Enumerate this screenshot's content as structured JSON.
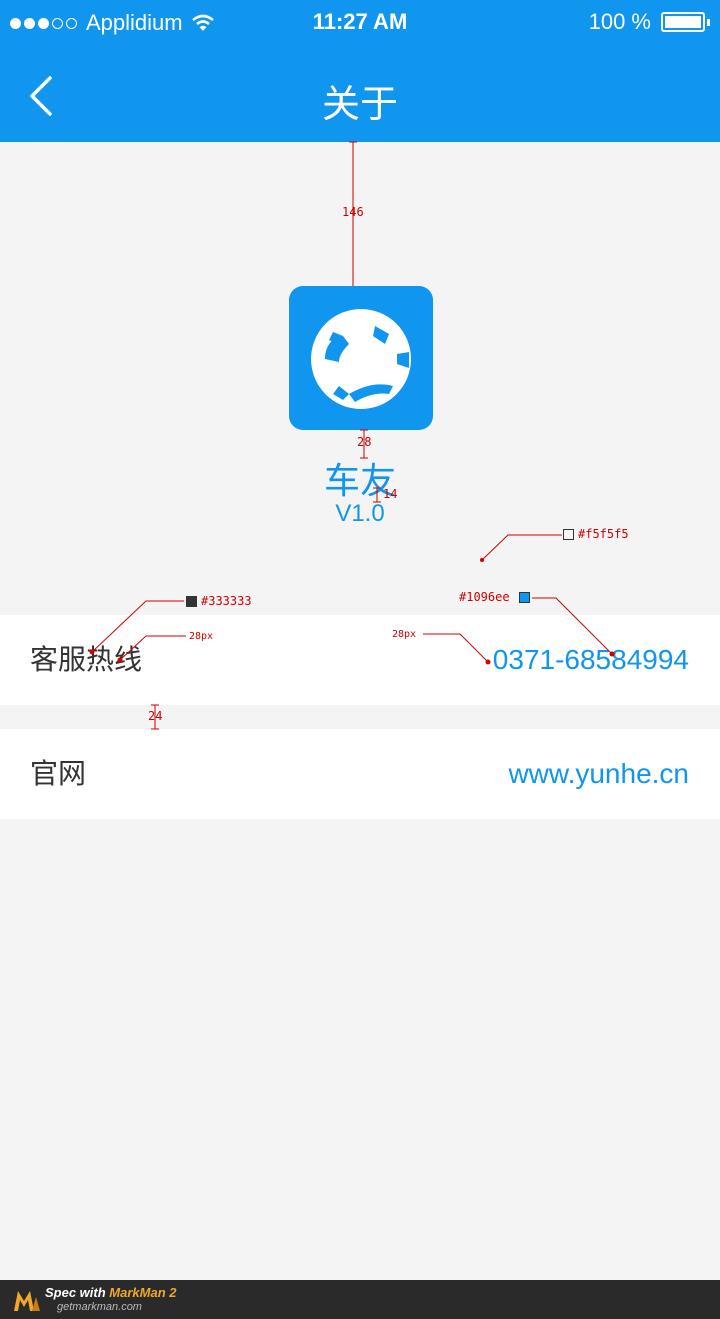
{
  "status_bar": {
    "carrier": "Applidium",
    "time": "11:27 AM",
    "battery": "100 %"
  },
  "nav": {
    "title": "关于",
    "back_icon": "chevron-left-icon"
  },
  "app": {
    "name": "车友",
    "version": "V1.0",
    "icon": "steering-wheel-icon"
  },
  "rows": [
    {
      "label": "客服热线",
      "value": "0371-68584994"
    },
    {
      "label": "官网",
      "value": "www.yunhe.cn"
    }
  ],
  "annotations": {
    "top_spacing": "146",
    "icon_name_gap": "28",
    "name_version_gap": "14",
    "bg_color": "#f5f5f5",
    "text_color": "#333333",
    "accent_color": "#1096ee",
    "label_font": "28px",
    "value_font": "28px",
    "row_gap": "24"
  },
  "footer": {
    "spec_prefix": "Spec with ",
    "brand": "MarkMan 2",
    "site": "getmarkman.com"
  },
  "colors": {
    "primary": "#1096ee",
    "text": "#333333",
    "background": "#f5f5f5"
  }
}
